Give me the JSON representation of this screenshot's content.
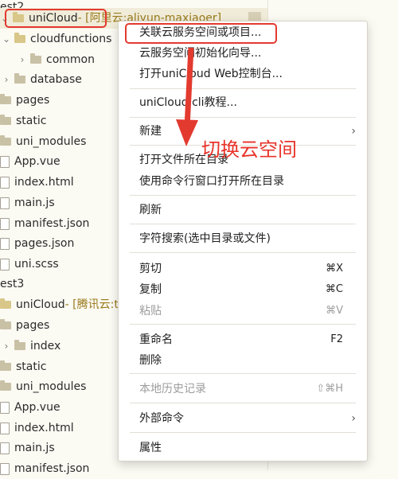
{
  "tree": {
    "items": [
      {
        "label": "est2",
        "indent": 0,
        "icon": "none",
        "chev": ""
      },
      {
        "label": "uniCloud",
        "hint": " - [阿里云:aliyun-maxiaoer]",
        "indent": 0,
        "icon": "cloud-folder",
        "chev": "down"
      },
      {
        "label": "cloudfunctions",
        "indent": 1,
        "icon": "cloud-folder",
        "chev": "down"
      },
      {
        "label": "common",
        "indent": 2,
        "icon": "folder",
        "chev": "right"
      },
      {
        "label": "database",
        "indent": 1,
        "icon": "folder",
        "chev": "right"
      },
      {
        "label": "pages",
        "indent": 0,
        "icon": "folder",
        "chev": ""
      },
      {
        "label": "static",
        "indent": 0,
        "icon": "folder",
        "chev": ""
      },
      {
        "label": "uni_modules",
        "indent": 0,
        "icon": "folder",
        "chev": ""
      },
      {
        "label": "App.vue",
        "indent": 0,
        "icon": "file",
        "chev": ""
      },
      {
        "label": "index.html",
        "indent": 0,
        "icon": "file",
        "chev": ""
      },
      {
        "label": "main.js",
        "indent": 0,
        "icon": "file",
        "chev": ""
      },
      {
        "label": "manifest.json",
        "indent": 0,
        "icon": "file",
        "chev": ""
      },
      {
        "label": "pages.json",
        "indent": 0,
        "icon": "file",
        "chev": ""
      },
      {
        "label": "uni.scss",
        "indent": 0,
        "icon": "file",
        "chev": ""
      },
      {
        "label": "est3",
        "indent": 0,
        "icon": "none",
        "chev": ""
      },
      {
        "label": "uniCloud",
        "hint": " - [腾讯云:t",
        "indent": 0,
        "icon": "cloud-folder",
        "chev": ""
      },
      {
        "label": "pages",
        "indent": 0,
        "icon": "folder",
        "chev": ""
      },
      {
        "label": "index",
        "indent": 1,
        "icon": "folder",
        "chev": "right"
      },
      {
        "label": "static",
        "indent": 0,
        "icon": "folder",
        "chev": ""
      },
      {
        "label": "uni_modules",
        "indent": 0,
        "icon": "folder",
        "chev": ""
      },
      {
        "label": "App.vue",
        "indent": 0,
        "icon": "file",
        "chev": ""
      },
      {
        "label": "index.html",
        "indent": 0,
        "icon": "file",
        "chev": ""
      },
      {
        "label": "main.js",
        "indent": 0,
        "icon": "file",
        "chev": ""
      },
      {
        "label": "manifest.json",
        "indent": 0,
        "icon": "file",
        "chev": ""
      }
    ]
  },
  "menu": {
    "items": [
      {
        "label": "关联云服务空间或项目...",
        "shortcut": "",
        "submenu": false,
        "disabled": false,
        "sep_after": false
      },
      {
        "label": "云服务空间初始化向导...",
        "shortcut": "",
        "submenu": false,
        "disabled": false,
        "sep_after": false
      },
      {
        "label": "打开uniCloud Web控制台...",
        "shortcut": "",
        "submenu": false,
        "disabled": false,
        "sep_after": true
      },
      {
        "label": "uniCloud cli教程...",
        "shortcut": "",
        "submenu": false,
        "disabled": false,
        "sep_after": true
      },
      {
        "label": "新建",
        "shortcut": "",
        "submenu": true,
        "disabled": false,
        "sep_after": true
      },
      {
        "label": "打开文件所在目录",
        "shortcut": "",
        "submenu": false,
        "disabled": false,
        "sep_after": false
      },
      {
        "label": "使用命令行窗口打开所在目录",
        "shortcut": "",
        "submenu": false,
        "disabled": false,
        "sep_after": true
      },
      {
        "label": "刷新",
        "shortcut": "",
        "submenu": false,
        "disabled": false,
        "sep_after": true
      },
      {
        "label": "字符搜索(选中目录或文件)",
        "shortcut": "",
        "submenu": false,
        "disabled": false,
        "sep_after": true
      },
      {
        "label": "剪切",
        "shortcut": "⌘X",
        "submenu": false,
        "disabled": false,
        "sep_after": false
      },
      {
        "label": "复制",
        "shortcut": "⌘C",
        "submenu": false,
        "disabled": false,
        "sep_after": false
      },
      {
        "label": "粘贴",
        "shortcut": "⌘V",
        "submenu": false,
        "disabled": true,
        "sep_after": true
      },
      {
        "label": "重命名",
        "shortcut": "F2",
        "submenu": false,
        "disabled": false,
        "sep_after": false
      },
      {
        "label": "删除",
        "shortcut": "",
        "submenu": false,
        "disabled": false,
        "sep_after": true
      },
      {
        "label": "本地历史记录",
        "shortcut": "⇧⌘H",
        "submenu": false,
        "disabled": true,
        "sep_after": true
      },
      {
        "label": "外部命令",
        "shortcut": "",
        "submenu": true,
        "disabled": false,
        "sep_after": true
      },
      {
        "label": "属性",
        "shortcut": "",
        "submenu": false,
        "disabled": false,
        "sep_after": false
      }
    ]
  },
  "annotation": {
    "text": "切换云空间",
    "color": "#e8332a"
  }
}
